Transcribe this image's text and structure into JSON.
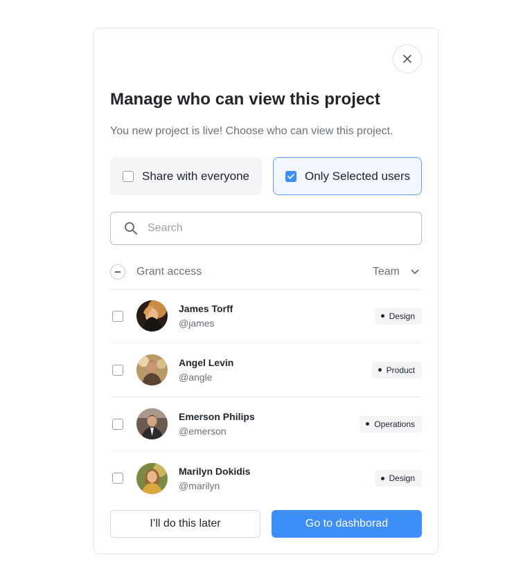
{
  "modal": {
    "title": "Manage who can view this project",
    "subtitle": "You new project is live! Choose who can view this project.",
    "close_icon": "close-icon"
  },
  "options": {
    "everyone_label": "Share with everyone",
    "everyone_checked": false,
    "selected_label": "Only Selected users",
    "selected_checked": true
  },
  "search": {
    "placeholder": "Search",
    "value": "",
    "icon": "search-icon"
  },
  "list_header": {
    "grant_label": "Grant access",
    "team_label": "Team",
    "team_icon": "chevron-down-icon"
  },
  "users": [
    {
      "name": "James Torff",
      "handle": "@james",
      "team": "Design",
      "checked": false
    },
    {
      "name": "Angel Levin",
      "handle": "@angle",
      "team": "Product",
      "checked": false
    },
    {
      "name": "Emerson Philips",
      "handle": "@emerson",
      "team": "Operations",
      "checked": false
    },
    {
      "name": "Marilyn Dokidis",
      "handle": "@marilyn",
      "team": "Design",
      "checked": false
    }
  ],
  "footer": {
    "later_label": "I’ll do this later",
    "dashboard_label": "Go to dashborad"
  },
  "colors": {
    "accent": "#3d8ef7",
    "selected_option_bg": "#f2f7ff",
    "selected_option_border": "#5e9ff5",
    "option_bg": "#f4f5f7",
    "badge_bg": "#f3f4f6"
  }
}
